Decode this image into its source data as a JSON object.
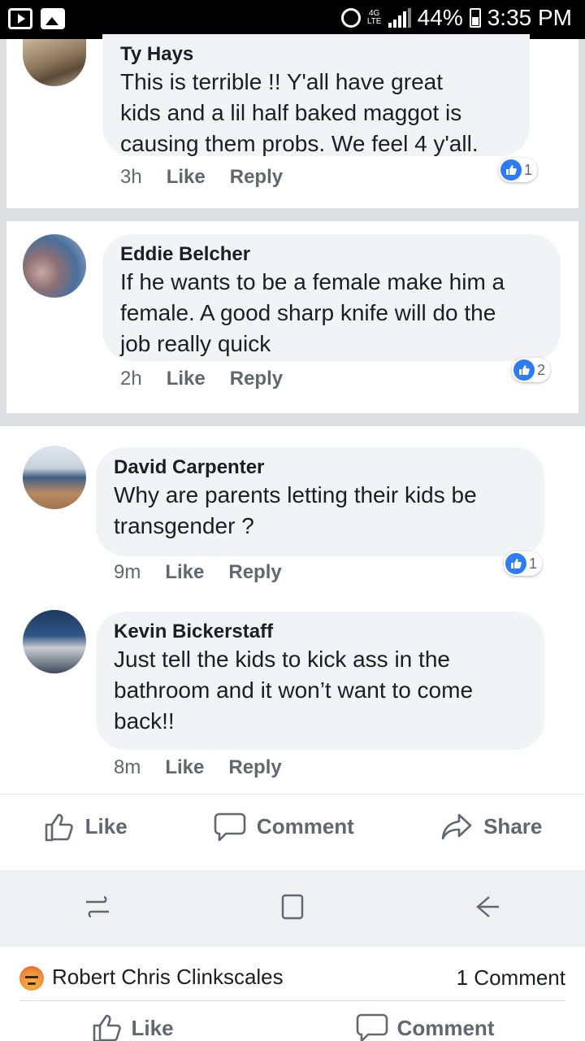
{
  "status_bar": {
    "signal_label": "4G LTE",
    "battery": "44%",
    "time": "3:35 PM"
  },
  "comments": [
    {
      "name": "Ty Hays",
      "text_lines": [
        "This is terrible !!    Y'all have great",
        "kids and a lil half baked maggot is",
        "causing them probs.    We feel 4 y'all."
      ],
      "time": "3h",
      "like_label": "Like",
      "reply_label": "Reply",
      "reaction_count": "1"
    },
    {
      "name": "Eddie Belcher",
      "text_lines": [
        "If he wants to be a female make him a",
        "female. A good sharp knife will do the",
        "job really quick"
      ],
      "time": "2h",
      "like_label": "Like",
      "reply_label": "Reply",
      "reaction_count": "2"
    },
    {
      "name": "David Carpenter",
      "text_lines": [
        "Why are parents letting their kids be",
        "transgender ?"
      ],
      "time": "9m",
      "like_label": "Like",
      "reply_label": "Reply",
      "reaction_count": "1"
    },
    {
      "name": "Kevin Bickerstaff",
      "text_lines": [
        "Just tell the kids to kick ass in the",
        "bathroom and it won’t want to come",
        "back!!"
      ],
      "time": "8m",
      "like_label": "Like",
      "reply_label": "Reply"
    }
  ],
  "post_actions": {
    "like": "Like",
    "comment": "Comment",
    "share": "Share"
  },
  "bottom": {
    "reactor_name": "Robert Chris Clinkscales",
    "comment_count": "1 Comment",
    "like": "Like",
    "comment": "Comment"
  },
  "colors": {
    "accent": "#2d7cf6",
    "bubble": "#f2f3f5",
    "meta_text": "#606770"
  },
  "icons": [
    "youtube-icon",
    "gallery-icon",
    "alarm-icon",
    "signal-icon",
    "battery-icon",
    "like-reaction-icon",
    "thumbs-up-icon",
    "comment-icon",
    "share-icon",
    "recent-apps-icon",
    "home-icon",
    "back-icon",
    "angry-reaction-icon"
  ]
}
